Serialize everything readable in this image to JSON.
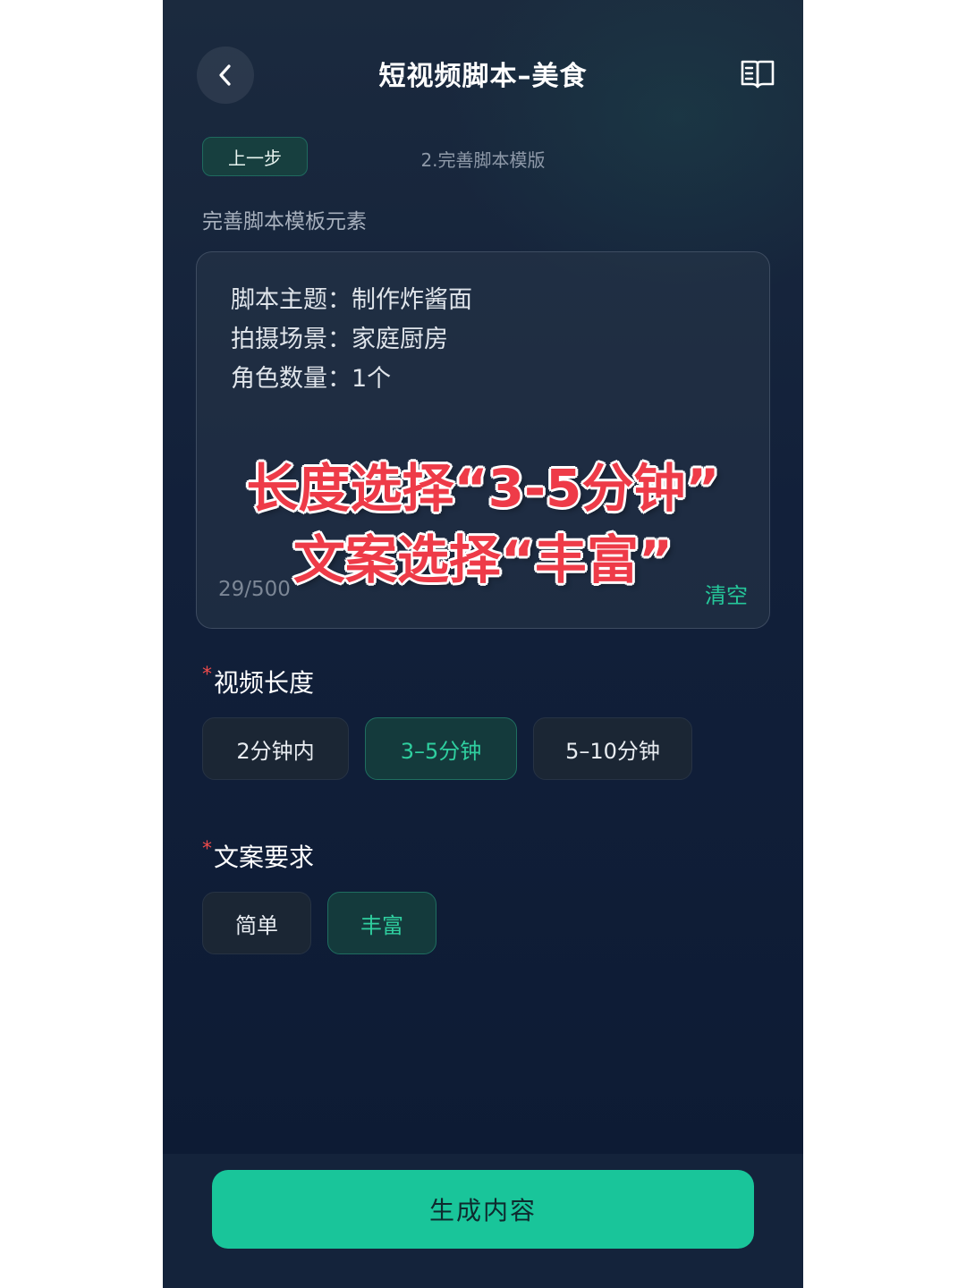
{
  "header": {
    "title": "短视频脚本–美食",
    "back_icon": "chevron-left-icon",
    "guide_icon": "book-icon"
  },
  "steps": {
    "prev_label": "上一步",
    "current_step": "2.完善脚本模版"
  },
  "section_caption": "完善脚本模板元素",
  "script_input": {
    "lines": [
      "脚本主题：制作炸酱面",
      "拍摄场景：家庭厨房",
      "角色数量：1个"
    ],
    "counter": "29/500",
    "clear_label": "清空"
  },
  "overlay_annotation": {
    "line1": "长度选择“3-5分钟”",
    "line2": "文案选择“丰富”"
  },
  "video_length": {
    "required_mark": "*",
    "label": "视频长度",
    "options": [
      "2分钟内",
      "3–5分钟",
      "5–10分钟"
    ],
    "selected": "3–5分钟"
  },
  "copy_requirement": {
    "required_mark": "*",
    "label": "文案要求",
    "options": [
      "简单",
      "丰富"
    ],
    "selected": "丰富"
  },
  "footer": {
    "generate_label": "生成内容"
  },
  "colors": {
    "accent": "#19c59a",
    "selected_text": "#2fcf9f",
    "required": "#ef4b4b",
    "overlay_text": "#ee3b48",
    "background": "#12203a"
  }
}
